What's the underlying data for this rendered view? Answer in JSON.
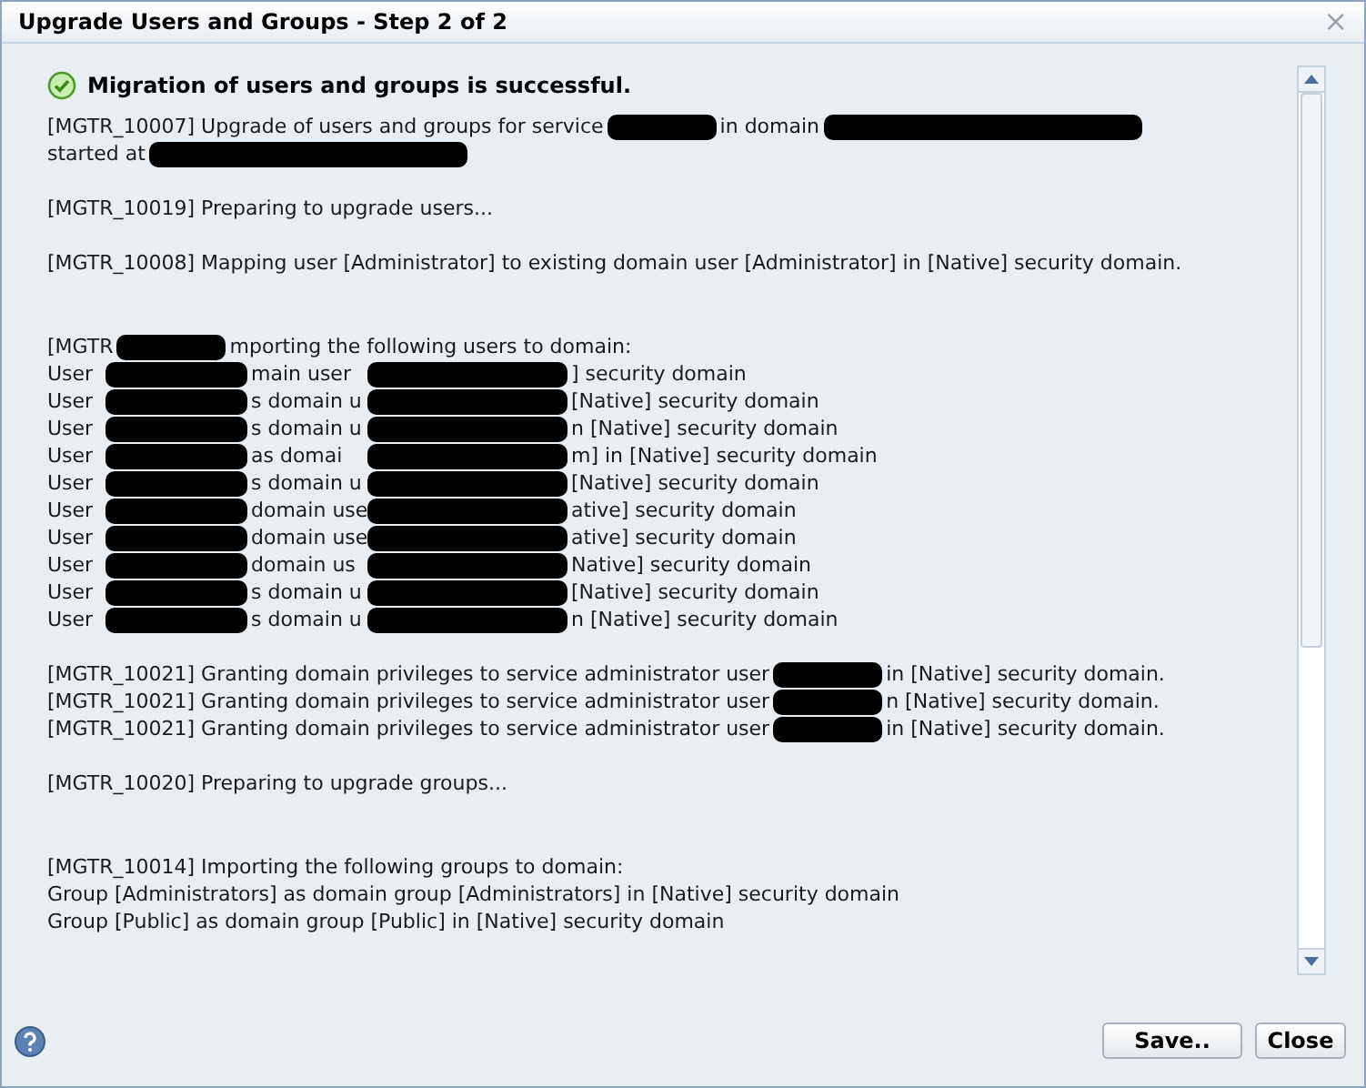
{
  "window": {
    "title": "Upgrade Users and Groups - Step 2 of 2",
    "close": "×"
  },
  "status": {
    "kind": "success",
    "message": "Migration of users and groups is successful."
  },
  "log": [
    {
      "kind": "message",
      "lines": [
        {
          "kind": "plain",
          "segments": [
            {
              "kind": "text",
              "text": "[MGTR_10007] Upgrade of users and groups for service"
            },
            {
              "kind": "redaction",
              "wide": false
            },
            {
              "kind": "text",
              "text": "in domain"
            },
            {
              "kind": "redaction",
              "wide": true
            }
          ]
        },
        {
          "kind": "plain",
          "segments": [
            {
              "kind": "text",
              "text": "started at"
            },
            {
              "kind": "redaction",
              "wide": true
            }
          ]
        }
      ]
    },
    {
      "kind": "message",
      "lines": [
        {
          "kind": "plain",
          "segments": [
            {
              "kind": "text",
              "text": "[MGTR_10019] Preparing to upgrade users..."
            }
          ]
        }
      ]
    },
    {
      "kind": "message",
      "lines": [
        {
          "kind": "plain",
          "segments": [
            {
              "kind": "text",
              "text": "[MGTR_10008] Mapping user [Administrator] to existing domain user [Administrator] in [Native] security domain."
            }
          ]
        }
      ]
    },
    {
      "kind": "list",
      "lines": [
        {
          "kind": "plain",
          "segments": [
            {
              "kind": "text",
              "text": "[MGTR"
            },
            {
              "kind": "redaction",
              "wide": false
            },
            {
              "kind": "text",
              "text": "mporting the following users to domain:"
            }
          ]
        },
        {
          "kind": "columns",
          "segments": [
            {
              "kind": "text",
              "text": "User"
            },
            {
              "kind": "redaction"
            },
            {
              "kind": "text",
              "text": "main user"
            },
            {
              "kind": "redaction"
            },
            {
              "kind": "text",
              "text": "] security domain"
            }
          ]
        },
        {
          "kind": "columns",
          "segments": [
            {
              "kind": "text",
              "text": "User"
            },
            {
              "kind": "redaction"
            },
            {
              "kind": "text",
              "text": "s domain u"
            },
            {
              "kind": "redaction"
            },
            {
              "kind": "text",
              "text": "[Native] security domain"
            }
          ]
        },
        {
          "kind": "columns",
          "segments": [
            {
              "kind": "text",
              "text": "User"
            },
            {
              "kind": "redaction"
            },
            {
              "kind": "text",
              "text": "s domain u"
            },
            {
              "kind": "redaction"
            },
            {
              "kind": "text",
              "text": "n [Native] security domain"
            }
          ]
        },
        {
          "kind": "columns",
          "segments": [
            {
              "kind": "text",
              "text": "User"
            },
            {
              "kind": "redaction"
            },
            {
              "kind": "text",
              "text": "as domai"
            },
            {
              "kind": "redaction"
            },
            {
              "kind": "text",
              "text": "m] in [Native] security domain"
            }
          ]
        },
        {
          "kind": "columns",
          "segments": [
            {
              "kind": "text",
              "text": "User"
            },
            {
              "kind": "redaction"
            },
            {
              "kind": "text",
              "text": "s domain u"
            },
            {
              "kind": "redaction"
            },
            {
              "kind": "text",
              "text": "[Native] security domain"
            }
          ]
        },
        {
          "kind": "columns",
          "segments": [
            {
              "kind": "text",
              "text": "User"
            },
            {
              "kind": "redaction"
            },
            {
              "kind": "text",
              "text": "domain use"
            },
            {
              "kind": "redaction"
            },
            {
              "kind": "text",
              "text": "ative] security domain"
            }
          ]
        },
        {
          "kind": "columns",
          "segments": [
            {
              "kind": "text",
              "text": "User"
            },
            {
              "kind": "redaction"
            },
            {
              "kind": "text",
              "text": "domain use"
            },
            {
              "kind": "redaction"
            },
            {
              "kind": "text",
              "text": "ative] security domain"
            }
          ]
        },
        {
          "kind": "columns",
          "segments": [
            {
              "kind": "text",
              "text": "User"
            },
            {
              "kind": "redaction"
            },
            {
              "kind": "text",
              "text": "domain us"
            },
            {
              "kind": "redaction"
            },
            {
              "kind": "text",
              "text": "Native] security domain"
            }
          ]
        },
        {
          "kind": "columns",
          "segments": [
            {
              "kind": "text",
              "text": "User"
            },
            {
              "kind": "redaction"
            },
            {
              "kind": "text",
              "text": "s domain u"
            },
            {
              "kind": "redaction"
            },
            {
              "kind": "text",
              "text": "[Native] security domain"
            }
          ]
        },
        {
          "kind": "columns",
          "segments": [
            {
              "kind": "text",
              "text": "User"
            },
            {
              "kind": "redaction"
            },
            {
              "kind": "text",
              "text": "s domain u"
            },
            {
              "kind": "redaction"
            },
            {
              "kind": "text",
              "text": "n [Native] security domain"
            }
          ]
        }
      ]
    },
    {
      "kind": "message",
      "lines": [
        {
          "kind": "plain",
          "segments": [
            {
              "kind": "text",
              "text": "[MGTR_10021] Granting domain privileges to service administrator user"
            },
            {
              "kind": "redaction",
              "wide": false
            },
            {
              "kind": "text",
              "text": "in [Native] security domain."
            }
          ]
        },
        {
          "kind": "plain",
          "segments": [
            {
              "kind": "text",
              "text": "[MGTR_10021] Granting domain privileges to service administrator user"
            },
            {
              "kind": "redaction",
              "wide": false
            },
            {
              "kind": "text",
              "text": "n [Native] security domain."
            }
          ]
        },
        {
          "kind": "plain",
          "segments": [
            {
              "kind": "text",
              "text": "[MGTR_10021] Granting domain privileges to service administrator user"
            },
            {
              "kind": "redaction",
              "wide": false
            },
            {
              "kind": "text",
              "text": "in [Native] security domain."
            }
          ]
        }
      ]
    },
    {
      "kind": "message",
      "lines": [
        {
          "kind": "plain",
          "segments": [
            {
              "kind": "text",
              "text": "[MGTR_10020] Preparing to upgrade groups..."
            }
          ]
        }
      ]
    },
    {
      "kind": "list",
      "lines": [
        {
          "kind": "plain",
          "segments": [
            {
              "kind": "text",
              "text": "[MGTR_10014] Importing the following groups to domain:"
            }
          ]
        },
        {
          "kind": "plain",
          "segments": [
            {
              "kind": "text",
              "text": "Group [Administrators] as domain group [Administrators] in [Native] security domain"
            }
          ]
        },
        {
          "kind": "plain",
          "segments": [
            {
              "kind": "text",
              "text": "Group [Public] as domain group [Public] in [Native] security domain"
            }
          ]
        }
      ]
    }
  ],
  "buttons": [
    {
      "label": "Save.."
    },
    {
      "label": "Close"
    }
  ]
}
